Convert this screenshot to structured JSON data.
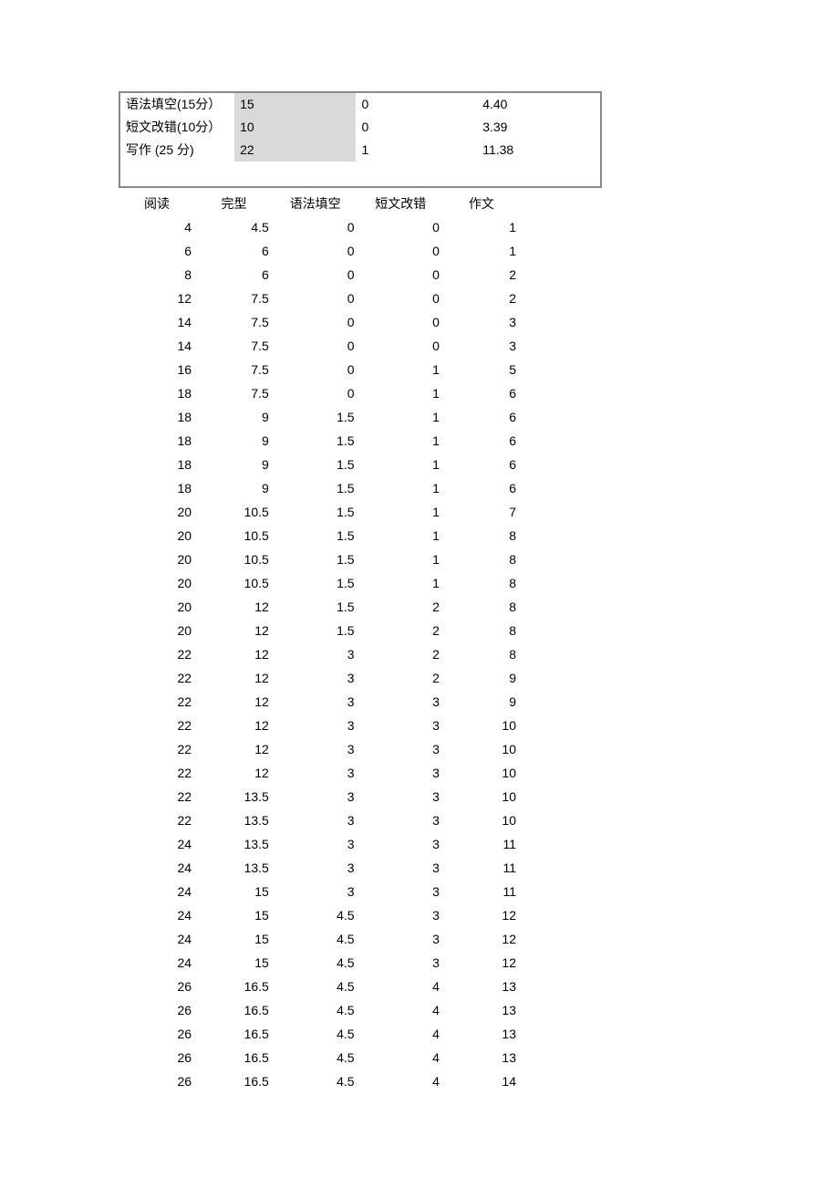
{
  "summary": {
    "rows": [
      {
        "label": "语法填空(15分）",
        "max": "15",
        "min": "0",
        "avg": "4.40"
      },
      {
        "label": "短文改错(10分）",
        "max": "10",
        "min": "0",
        "avg": "3.39"
      },
      {
        "label": "写作 (25 分)",
        "max": "22",
        "min": "1",
        "avg": "11.38"
      }
    ]
  },
  "dataTable": {
    "headers": [
      "阅读",
      "完型",
      "语法填空",
      "短文改错",
      "作文"
    ],
    "rows": [
      [
        "4",
        "4.5",
        "0",
        "0",
        "1"
      ],
      [
        "6",
        "6",
        "0",
        "0",
        "1"
      ],
      [
        "8",
        "6",
        "0",
        "0",
        "2"
      ],
      [
        "12",
        "7.5",
        "0",
        "0",
        "2"
      ],
      [
        "14",
        "7.5",
        "0",
        "0",
        "3"
      ],
      [
        "14",
        "7.5",
        "0",
        "0",
        "3"
      ],
      [
        "16",
        "7.5",
        "0",
        "1",
        "5"
      ],
      [
        "18",
        "7.5",
        "0",
        "1",
        "6"
      ],
      [
        "18",
        "9",
        "1.5",
        "1",
        "6"
      ],
      [
        "18",
        "9",
        "1.5",
        "1",
        "6"
      ],
      [
        "18",
        "9",
        "1.5",
        "1",
        "6"
      ],
      [
        "18",
        "9",
        "1.5",
        "1",
        "6"
      ],
      [
        "20",
        "10.5",
        "1.5",
        "1",
        "7"
      ],
      [
        "20",
        "10.5",
        "1.5",
        "1",
        "8"
      ],
      [
        "20",
        "10.5",
        "1.5",
        "1",
        "8"
      ],
      [
        "20",
        "10.5",
        "1.5",
        "1",
        "8"
      ],
      [
        "20",
        "12",
        "1.5",
        "2",
        "8"
      ],
      [
        "20",
        "12",
        "1.5",
        "2",
        "8"
      ],
      [
        "22",
        "12",
        "3",
        "2",
        "8"
      ],
      [
        "22",
        "12",
        "3",
        "2",
        "9"
      ],
      [
        "22",
        "12",
        "3",
        "3",
        "9"
      ],
      [
        "22",
        "12",
        "3",
        "3",
        "10"
      ],
      [
        "22",
        "12",
        "3",
        "3",
        "10"
      ],
      [
        "22",
        "12",
        "3",
        "3",
        "10"
      ],
      [
        "22",
        "13.5",
        "3",
        "3",
        "10"
      ],
      [
        "22",
        "13.5",
        "3",
        "3",
        "10"
      ],
      [
        "24",
        "13.5",
        "3",
        "3",
        "11"
      ],
      [
        "24",
        "13.5",
        "3",
        "3",
        "11"
      ],
      [
        "24",
        "15",
        "3",
        "3",
        "11"
      ],
      [
        "24",
        "15",
        "4.5",
        "3",
        "12"
      ],
      [
        "24",
        "15",
        "4.5",
        "3",
        "12"
      ],
      [
        "24",
        "15",
        "4.5",
        "3",
        "12"
      ],
      [
        "26",
        "16.5",
        "4.5",
        "4",
        "13"
      ],
      [
        "26",
        "16.5",
        "4.5",
        "4",
        "13"
      ],
      [
        "26",
        "16.5",
        "4.5",
        "4",
        "13"
      ],
      [
        "26",
        "16.5",
        "4.5",
        "4",
        "13"
      ],
      [
        "26",
        "16.5",
        "4.5",
        "4",
        "14"
      ]
    ]
  }
}
